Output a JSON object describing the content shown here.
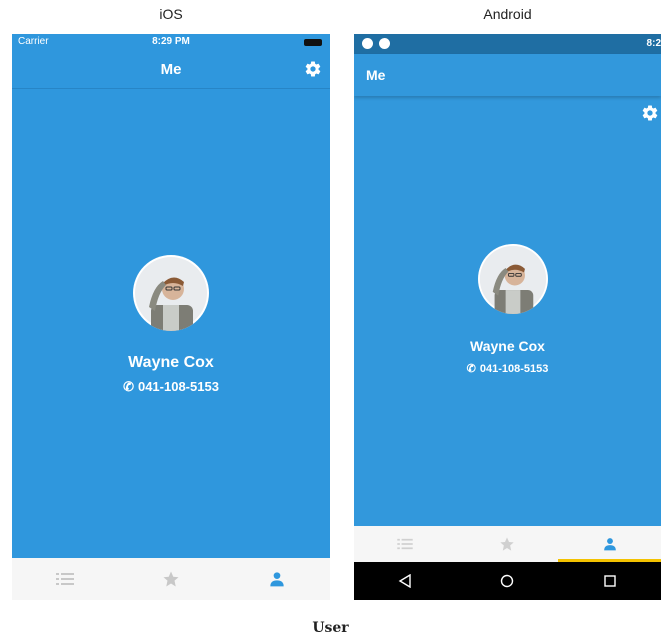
{
  "labels": {
    "ios": "iOS",
    "android": "Android",
    "caption": "User"
  },
  "ios": {
    "status": {
      "carrier": "Carrier",
      "time": "8:29 PM"
    },
    "nav_title": "Me",
    "user": {
      "name": "Wayne Cox",
      "phone": "041-108-5153"
    },
    "tabs": [
      {
        "icon": "list-icon",
        "active": false
      },
      {
        "icon": "star-icon",
        "active": false
      },
      {
        "icon": "person-icon",
        "active": true
      }
    ]
  },
  "android": {
    "status": {
      "clock": "8:2"
    },
    "toolbar_title": "Me",
    "user": {
      "name": "Wayne Cox",
      "phone": "041-108-5153"
    },
    "tabs": [
      {
        "icon": "list-icon",
        "active": false
      },
      {
        "icon": "star-icon",
        "active": false
      },
      {
        "icon": "person-icon",
        "active": true
      }
    ],
    "nav_buttons": [
      "back-icon",
      "home-icon",
      "recents-icon"
    ]
  },
  "colors": {
    "primary": "#2f97dd",
    "android_status": "#1f6ea3",
    "tab_active": "#2f97dd",
    "tab_inactive": "#c8c8c8",
    "android_tab_indicator": "#f3c200"
  }
}
